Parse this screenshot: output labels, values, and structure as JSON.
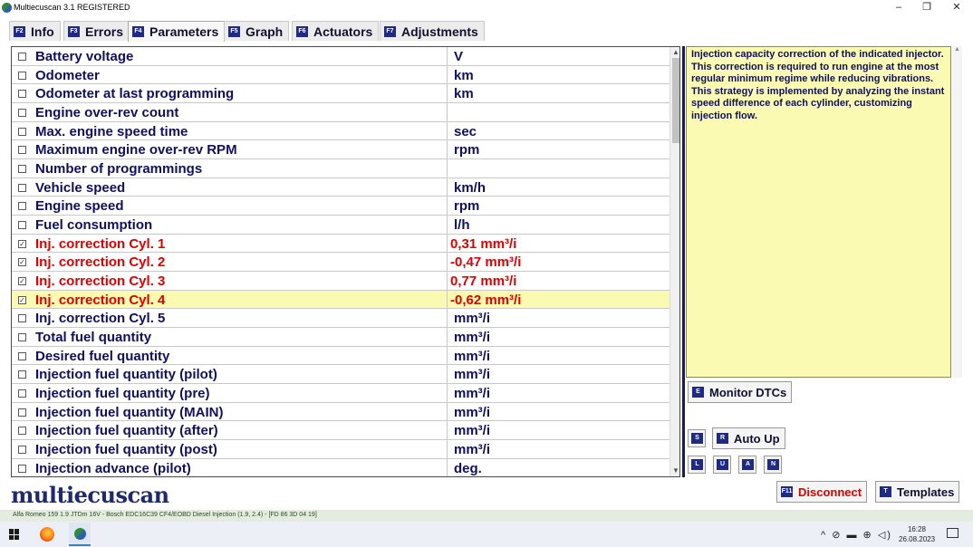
{
  "window": {
    "title": "Multiecuscan 3.1 REGISTERED",
    "controls": {
      "minimize": "–",
      "maximize": "❐",
      "close": "✕"
    }
  },
  "tabs": [
    {
      "key": "F2",
      "label": "Info"
    },
    {
      "key": "F3",
      "label": "Errors"
    },
    {
      "key": "F4",
      "label": "Parameters",
      "active": true
    },
    {
      "key": "F5",
      "label": "Graph"
    },
    {
      "key": "F6",
      "label": "Actuators"
    },
    {
      "key": "F7",
      "label": "Adjustments"
    }
  ],
  "parameters": [
    {
      "name": "Battery voltage",
      "value": "V",
      "checked": false
    },
    {
      "name": "Odometer",
      "value": "km",
      "checked": false
    },
    {
      "name": "Odometer at last programming",
      "value": "km",
      "checked": false
    },
    {
      "name": "Engine over-rev count",
      "value": "",
      "checked": false
    },
    {
      "name": "Max. engine speed time",
      "value": "sec",
      "checked": false
    },
    {
      "name": "Maximum engine over-rev RPM",
      "value": "rpm",
      "checked": false
    },
    {
      "name": "Number of programmings",
      "value": "",
      "checked": false
    },
    {
      "name": "Vehicle speed",
      "value": "km/h",
      "checked": false
    },
    {
      "name": "Engine speed",
      "value": "rpm",
      "checked": false
    },
    {
      "name": "Fuel consumption",
      "value": "l/h",
      "checked": false
    },
    {
      "name": "Inj. correction Cyl. 1",
      "value": "0,31 mm³/i",
      "checked": true
    },
    {
      "name": "Inj. correction Cyl. 2",
      "value": "-0,47 mm³/i",
      "checked": true
    },
    {
      "name": "Inj. correction Cyl. 3",
      "value": "0,77 mm³/i",
      "checked": true
    },
    {
      "name": "Inj. correction Cyl. 4",
      "value": "-0,62 mm³/i",
      "checked": true,
      "selected": true
    },
    {
      "name": "Inj. correction Cyl. 5",
      "value": "mm³/i",
      "checked": false
    },
    {
      "name": "Total fuel quantity",
      "value": "mm³/i",
      "checked": false
    },
    {
      "name": "Desired fuel quantity",
      "value": "mm³/i",
      "checked": false
    },
    {
      "name": "Injection fuel quantity (pilot)",
      "value": "mm³/i",
      "checked": false
    },
    {
      "name": "Injection fuel quantity (pre)",
      "value": "mm³/i",
      "checked": false
    },
    {
      "name": "Injection fuel quantity (MAIN)",
      "value": "mm³/i",
      "checked": false
    },
    {
      "name": "Injection fuel quantity (after)",
      "value": "mm³/i",
      "checked": false
    },
    {
      "name": "Injection fuel quantity (post)",
      "value": "mm³/i",
      "checked": false
    },
    {
      "name": "Injection advance (pilot)",
      "value": "deg.",
      "checked": false
    }
  ],
  "description": "Injection capacity correction of the indicated injector. This correction is required to run engine at the most regular minimum regime while reducing vibrations. This strategy is implemented by analyzing the instant speed difference of each cylinder, customizing injection flow.",
  "buttons": {
    "monitor_dtcs": {
      "key": "E",
      "label": "Monitor DTCs"
    },
    "s": {
      "key": "S"
    },
    "auto_up": {
      "key": "R",
      "label": "Auto Up"
    },
    "l": {
      "key": "L"
    },
    "u": {
      "key": "U"
    },
    "a": {
      "key": "A"
    },
    "n": {
      "key": "N"
    },
    "disconnect": {
      "key": "F11",
      "label": "Disconnect"
    },
    "templates": {
      "key": "T",
      "label": "Templates"
    }
  },
  "logo": "multiecuscan",
  "status": "Alfa Romeo 159 1.9 JTDm 16V - Bosch EDC16C39 CF4/EOBD Diesel Injection (1.9, 2.4) - [FD 86 3D 04 19]",
  "taskbar": {
    "tray_icons": "^ ⊘ ▬ ⊕ ◁)",
    "time": "16:28",
    "date": "26.08.2023"
  },
  "colors": {
    "checked_text": "#e00000",
    "label_text": "#101060",
    "highlight_row": "#fafab2",
    "key_badge": "#1f2a85"
  }
}
